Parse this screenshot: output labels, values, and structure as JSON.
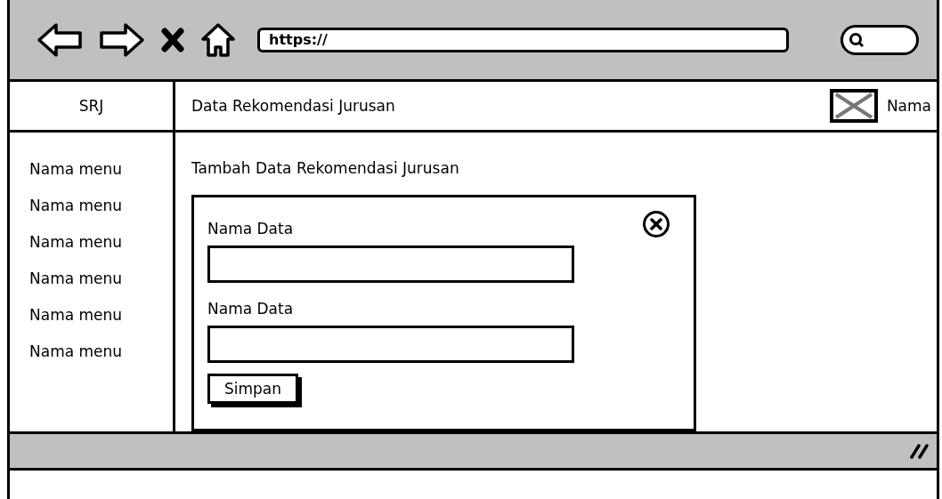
{
  "browser": {
    "url": "https://"
  },
  "header": {
    "brand": "SRJ",
    "page_title": "Data Rekomendasi Jurusan",
    "user_name": "Nama"
  },
  "sidebar": {
    "items": [
      {
        "label": "Nama menu"
      },
      {
        "label": "Nama menu"
      },
      {
        "label": "Nama menu"
      },
      {
        "label": "Nama menu"
      },
      {
        "label": "Nama menu"
      },
      {
        "label": "Nama menu"
      }
    ]
  },
  "content": {
    "heading": "Tambah Data Rekomendasi Jurusan",
    "form": {
      "fields": [
        {
          "label": "Nama Data"
        },
        {
          "label": "Nama Data"
        }
      ],
      "submit": "Simpan"
    }
  }
}
